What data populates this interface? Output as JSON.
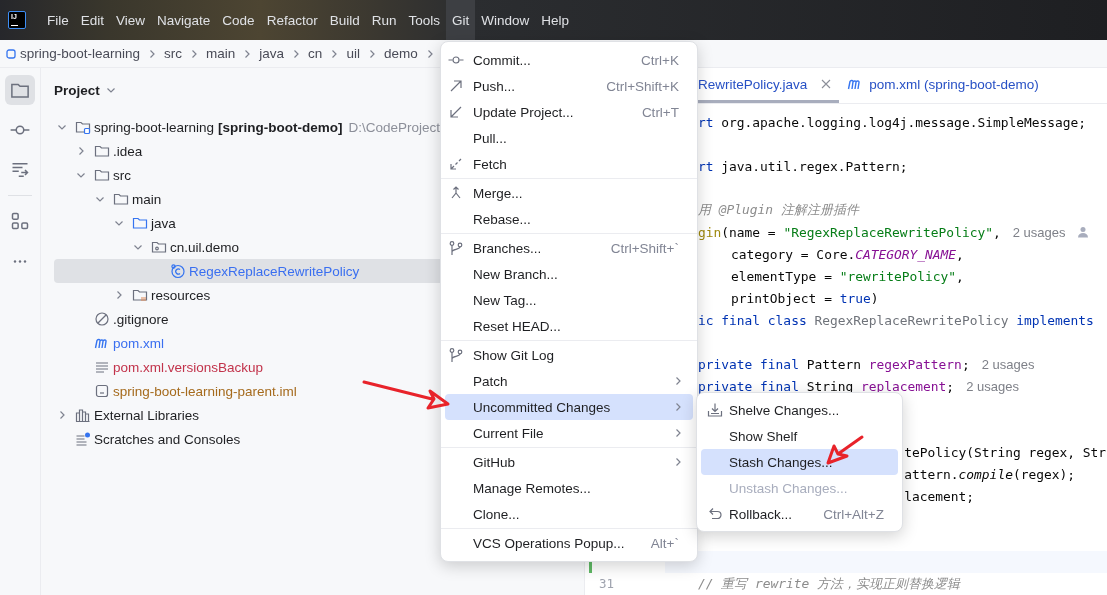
{
  "app_logo": {
    "text": "IJ"
  },
  "menubar": [
    {
      "label": "File",
      "selected": false
    },
    {
      "label": "Edit",
      "selected": false
    },
    {
      "label": "View",
      "selected": false
    },
    {
      "label": "Navigate",
      "selected": false
    },
    {
      "label": "Code",
      "selected": false
    },
    {
      "label": "Refactor",
      "selected": false
    },
    {
      "label": "Build",
      "selected": false
    },
    {
      "label": "Run",
      "selected": false
    },
    {
      "label": "Tools",
      "selected": false
    },
    {
      "label": "Git",
      "selected": true
    },
    {
      "label": "Window",
      "selected": false
    },
    {
      "label": "Help",
      "selected": false
    }
  ],
  "breadcrumb": [
    {
      "kind": "module",
      "label": "spring-boot-learning"
    },
    {
      "kind": "folder",
      "label": "src"
    },
    {
      "kind": "folder",
      "label": "main"
    },
    {
      "kind": "folder",
      "label": "java"
    },
    {
      "kind": "folder",
      "label": "cn"
    },
    {
      "kind": "folder",
      "label": "uil"
    },
    {
      "kind": "folder",
      "label": "demo"
    }
  ],
  "tool_stripe": [
    {
      "items": [
        {
          "kind": "project",
          "selected": true
        },
        {
          "kind": "commit",
          "selected": false
        },
        {
          "kind": "pull_requests",
          "selected": false
        }
      ]
    },
    {
      "items": [
        {
          "kind": "plugins",
          "selected": false
        },
        {
          "kind": "more",
          "selected": false
        }
      ]
    }
  ],
  "project_panel": {
    "title": "Project",
    "tree": [
      {
        "kind": "project",
        "label": "spring-boot-learning",
        "module": "[spring-boot-demo]",
        "path": "D:\\CodeProject",
        "expanded": true,
        "selected": false,
        "color": "#1e1f22",
        "children": [
          {
            "kind": "folder",
            "label": ".idea",
            "expanded": false,
            "selected": false,
            "color": "#1e1f22"
          },
          {
            "kind": "folder",
            "label": "src",
            "expanded": true,
            "selected": false,
            "color": "#1e1f22",
            "children": [
              {
                "kind": "folder",
                "label": "main",
                "expanded": true,
                "selected": false,
                "color": "#1e1f22",
                "children": [
                  {
                    "kind": "source_folder",
                    "label": "java",
                    "expanded": true,
                    "selected": false,
                    "color": "#1e1f22",
                    "children": [
                      {
                        "kind": "package",
                        "label": "cn.uil.demo",
                        "expanded": true,
                        "selected": false,
                        "color": "#1e1f22",
                        "children": [
                          {
                            "kind": "class",
                            "label": "RegexReplaceRewritePolicy",
                            "selected": true,
                            "color": "#3a6ff0"
                          }
                        ]
                      }
                    ]
                  },
                  {
                    "kind": "resources_folder",
                    "label": "resources",
                    "expanded": false,
                    "selected": false,
                    "color": "#1e1f22"
                  }
                ]
              }
            ]
          },
          {
            "kind": "ignore_file",
            "label": ".gitignore",
            "selected": false,
            "color": "#1e1f22"
          },
          {
            "kind": "maven",
            "label": "pom.xml",
            "selected": false,
            "color": "#3a6ff0"
          },
          {
            "kind": "text_file",
            "label": "pom.xml.versionsBackup",
            "selected": false,
            "color": "#c2334b"
          },
          {
            "kind": "iml",
            "label": "spring-boot-learning-parent.iml",
            "selected": false,
            "color": "#a56a1c"
          }
        ]
      },
      {
        "kind": "libraries",
        "label": "External Libraries",
        "expanded": false,
        "selected": false,
        "color": "#1e1f22"
      },
      {
        "kind": "scratches",
        "label": "Scratches and Consoles",
        "selected": false,
        "color": "#1e1f22"
      }
    ]
  },
  "editor_tabs": [
    {
      "kind": "plain",
      "label": "RewritePolicy.java",
      "selected": true,
      "closable": true
    },
    {
      "kind": "maven",
      "label": "pom.xml (spring-boot-demo)",
      "selected": false,
      "closable": false
    }
  ],
  "code_lines": [
    {
      "kind": "code",
      "tokens": [
        {
          "kind": "keyword",
          "text": "rt"
        },
        {
          "kind": "plain",
          "text": " org.apache.logging.log4j.message.SimpleMessage;"
        }
      ]
    },
    {
      "kind": "blank"
    },
    {
      "kind": "code",
      "tokens": [
        {
          "kind": "keyword",
          "text": "rt"
        },
        {
          "kind": "plain",
          "text": " java.util.regex.Pattern;"
        }
      ]
    },
    {
      "kind": "blank"
    },
    {
      "kind": "code",
      "tokens": [
        {
          "kind": "comment",
          "text": "用 @Plugin 注解注册插件"
        }
      ]
    },
    {
      "kind": "code",
      "tokens": [
        {
          "kind": "annotation",
          "text": "gin"
        },
        {
          "kind": "plain",
          "text": "(name = "
        },
        {
          "kind": "string",
          "text": "\"RegexReplaceRewritePolicy\""
        },
        {
          "kind": "plain",
          "text": ","
        }
      ],
      "hint": "2 usages",
      "author": true
    },
    {
      "kind": "code",
      "tokens": [
        {
          "kind": "plain",
          "text": "    category = Core."
        },
        {
          "kind": "static",
          "text": "CATEGORY_NAME"
        },
        {
          "kind": "plain",
          "text": ","
        }
      ]
    },
    {
      "kind": "code",
      "tokens": [
        {
          "kind": "plain",
          "text": "    elementType = "
        },
        {
          "kind": "string",
          "text": "\"rewritePolicy\""
        },
        {
          "kind": "plain",
          "text": ","
        }
      ]
    },
    {
      "kind": "code",
      "tokens": [
        {
          "kind": "plain",
          "text": "    printObject = "
        },
        {
          "kind": "keyword",
          "text": "true"
        },
        {
          "kind": "plain",
          "text": ")"
        }
      ]
    },
    {
      "kind": "code",
      "tokens": [
        {
          "kind": "keyword",
          "text": "ic final class "
        },
        {
          "kind": "dim",
          "text": "RegexReplaceRewritePolicy "
        },
        {
          "kind": "keyword",
          "text": "implements"
        }
      ]
    },
    {
      "kind": "blank"
    },
    {
      "kind": "code",
      "tokens": [
        {
          "kind": "keyword",
          "text": "private final "
        },
        {
          "kind": "plain",
          "text": "Pattern "
        },
        {
          "kind": "field",
          "text": "regexPattern"
        },
        {
          "kind": "plain",
          "text": ";"
        }
      ],
      "hint": "2 usages"
    },
    {
      "kind": "code",
      "tokens": [
        {
          "kind": "keyword",
          "text": "private final "
        },
        {
          "kind": "plain",
          "text": "String "
        },
        {
          "kind": "field",
          "text": "replacement"
        },
        {
          "kind": "plain",
          "text": ";"
        }
      ],
      "hint": "2 usages"
    },
    {
      "kind": "blank"
    },
    {
      "kind": "blank"
    },
    {
      "kind": "code",
      "tokens": [
        {
          "kind": "plain",
          "text": "                         tePolicy(String regex, Str"
        }
      ]
    },
    {
      "kind": "code",
      "tokens": [
        {
          "kind": "plain",
          "text": "                         attern."
        },
        {
          "kind": "method",
          "text": "compile"
        },
        {
          "kind": "plain",
          "text": "(regex);"
        }
      ]
    },
    {
      "kind": "code",
      "tokens": [
        {
          "kind": "plain",
          "text": "                         lacement;"
        }
      ]
    },
    {
      "kind": "blank"
    },
    {
      "kind": "blank"
    },
    {
      "kind": "blank",
      "current": true,
      "changed": true
    },
    {
      "kind": "code",
      "number": "31",
      "tokens": [
        {
          "kind": "comment",
          "text": "// 重写 rewrite 方法，实现正则替换逻辑"
        }
      ]
    }
  ],
  "git_menu": {
    "groups": [
      {
        "items": [
          {
            "kind": "commit",
            "label": "Commit...",
            "shortcut": "Ctrl+K",
            "submenu": false,
            "selected": false
          },
          {
            "kind": "push",
            "label": "Push...",
            "shortcut": "Ctrl+Shift+K",
            "submenu": false,
            "selected": false
          },
          {
            "kind": "update",
            "label": "Update Project...",
            "shortcut": "Ctrl+T",
            "submenu": false,
            "selected": false
          },
          {
            "kind": "plain",
            "label": "Pull...",
            "submenu": false,
            "selected": false
          },
          {
            "kind": "fetch",
            "label": "Fetch",
            "submenu": false,
            "selected": false
          }
        ]
      },
      {
        "items": [
          {
            "kind": "merge",
            "label": "Merge...",
            "submenu": false,
            "selected": false
          },
          {
            "kind": "plain",
            "label": "Rebase...",
            "submenu": false,
            "selected": false
          }
        ]
      },
      {
        "items": [
          {
            "kind": "branch",
            "label": "Branches...",
            "shortcut": "Ctrl+Shift+`",
            "submenu": false,
            "selected": false
          },
          {
            "kind": "plain",
            "label": "New Branch...",
            "submenu": false,
            "selected": false
          },
          {
            "kind": "plain",
            "label": "New Tag...",
            "submenu": false,
            "selected": false
          },
          {
            "kind": "plain",
            "label": "Reset HEAD...",
            "submenu": false,
            "selected": false
          }
        ]
      },
      {
        "items": [
          {
            "kind": "branch",
            "label": "Show Git Log",
            "submenu": false,
            "selected": false
          },
          {
            "kind": "plain",
            "label": "Patch",
            "submenu": true,
            "selected": false
          },
          {
            "kind": "plain",
            "label": "Uncommitted Changes",
            "submenu": true,
            "selected": true
          },
          {
            "kind": "plain",
            "label": "Current File",
            "submenu": true,
            "selected": false
          }
        ]
      },
      {
        "items": [
          {
            "kind": "plain",
            "label": "GitHub",
            "submenu": true,
            "selected": false
          },
          {
            "kind": "plain",
            "label": "Manage Remotes...",
            "submenu": false,
            "selected": false
          },
          {
            "kind": "plain",
            "label": "Clone...",
            "submenu": false,
            "selected": false
          }
        ]
      },
      {
        "items": [
          {
            "kind": "plain",
            "label": "VCS Operations Popup...",
            "shortcut": "Alt+`",
            "submenu": false,
            "selected": false
          }
        ]
      }
    ]
  },
  "uncommitted_submenu": {
    "items": [
      {
        "kind": "shelve",
        "label": "Shelve Changes...",
        "selected": false,
        "disabled": false
      },
      {
        "kind": "plain",
        "label": "Show Shelf",
        "selected": false,
        "disabled": false
      },
      {
        "kind": "plain",
        "label": "Stash Changes...",
        "selected": true,
        "disabled": false
      },
      {
        "kind": "plain",
        "label": "Unstash Changes...",
        "selected": false,
        "disabled": true
      },
      {
        "kind": "rollback",
        "label": "Rollback...",
        "shortcut": "Ctrl+Alt+Z",
        "selected": false,
        "disabled": false
      }
    ]
  }
}
